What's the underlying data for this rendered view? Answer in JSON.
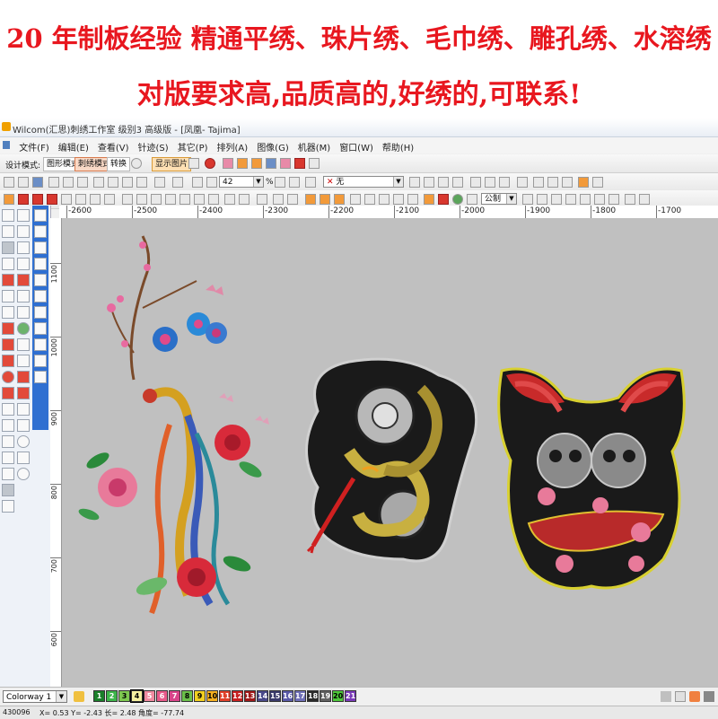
{
  "banner": {
    "line1": "20 年制板经验 精通平绣、珠片绣、毛巾绣、雕孔绣、水溶绣",
    "line2": "对版要求高,品质高的,好绣的,可联系!"
  },
  "window": {
    "title": "Wilcom(汇思)刺绣工作室  级别3 高级版 - [凤凰-          Tajima]"
  },
  "menu": [
    "文件(F)",
    "编辑(E)",
    "查看(V)",
    "针迹(S)",
    "其它(P)",
    "排列(A)",
    "图像(G)",
    "机器(M)",
    "窗口(W)",
    "帮助(H)"
  ],
  "toolbar1": {
    "design_mode_label": "设计模式:",
    "graphic_mode": "图形模式",
    "embroidery_mode": "刺绣模式",
    "convert": "转换",
    "show_image": "显示图片"
  },
  "toolbar2": {
    "zoom_value": "42",
    "zoom_unit": "%",
    "fabric_value": "无"
  },
  "toolbar3": {
    "units_value": "公制"
  },
  "ruler_top": [
    "-2600",
    "-2500",
    "-2400",
    "-2300",
    "-2200",
    "-2100",
    "-2000",
    "-1900",
    "-1800",
    "-1700"
  ],
  "ruler_left": [
    "1100",
    "1000",
    "900",
    "800",
    "700",
    "600"
  ],
  "status": {
    "colorway": "Colorway 1",
    "swatches": [
      {
        "num": "1",
        "color": "#1a7f2a"
      },
      {
        "num": "2",
        "color": "#3db54a"
      },
      {
        "num": "3",
        "color": "#7ec850"
      },
      {
        "num": "4",
        "color": "#f5f0a0"
      },
      {
        "num": "5",
        "color": "#f08aa0"
      },
      {
        "num": "6",
        "color": "#e85a8a"
      },
      {
        "num": "7",
        "color": "#d9448a"
      },
      {
        "num": "8",
        "color": "#6bc04a"
      },
      {
        "num": "9",
        "color": "#f2d020"
      },
      {
        "num": "10",
        "color": "#f6b020"
      },
      {
        "num": "11",
        "color": "#e0402a"
      },
      {
        "num": "12",
        "color": "#c82020"
      },
      {
        "num": "13",
        "color": "#a01818"
      },
      {
        "num": "14",
        "color": "#4a4a8a"
      },
      {
        "num": "15",
        "color": "#3a3a6a"
      },
      {
        "num": "16",
        "color": "#5a5aa8"
      },
      {
        "num": "17",
        "color": "#7070b8"
      },
      {
        "num": "18",
        "color": "#2a2a2a"
      },
      {
        "num": "19",
        "color": "#606060"
      },
      {
        "num": "20",
        "color": "#4ec83a"
      },
      {
        "num": "21",
        "color": "#7a3ab8"
      }
    ]
  },
  "coords": {
    "stitch_count": "430096",
    "x": "X=   0.53 Y=  -2.43 长=   2.48 角度=  -77.74"
  }
}
